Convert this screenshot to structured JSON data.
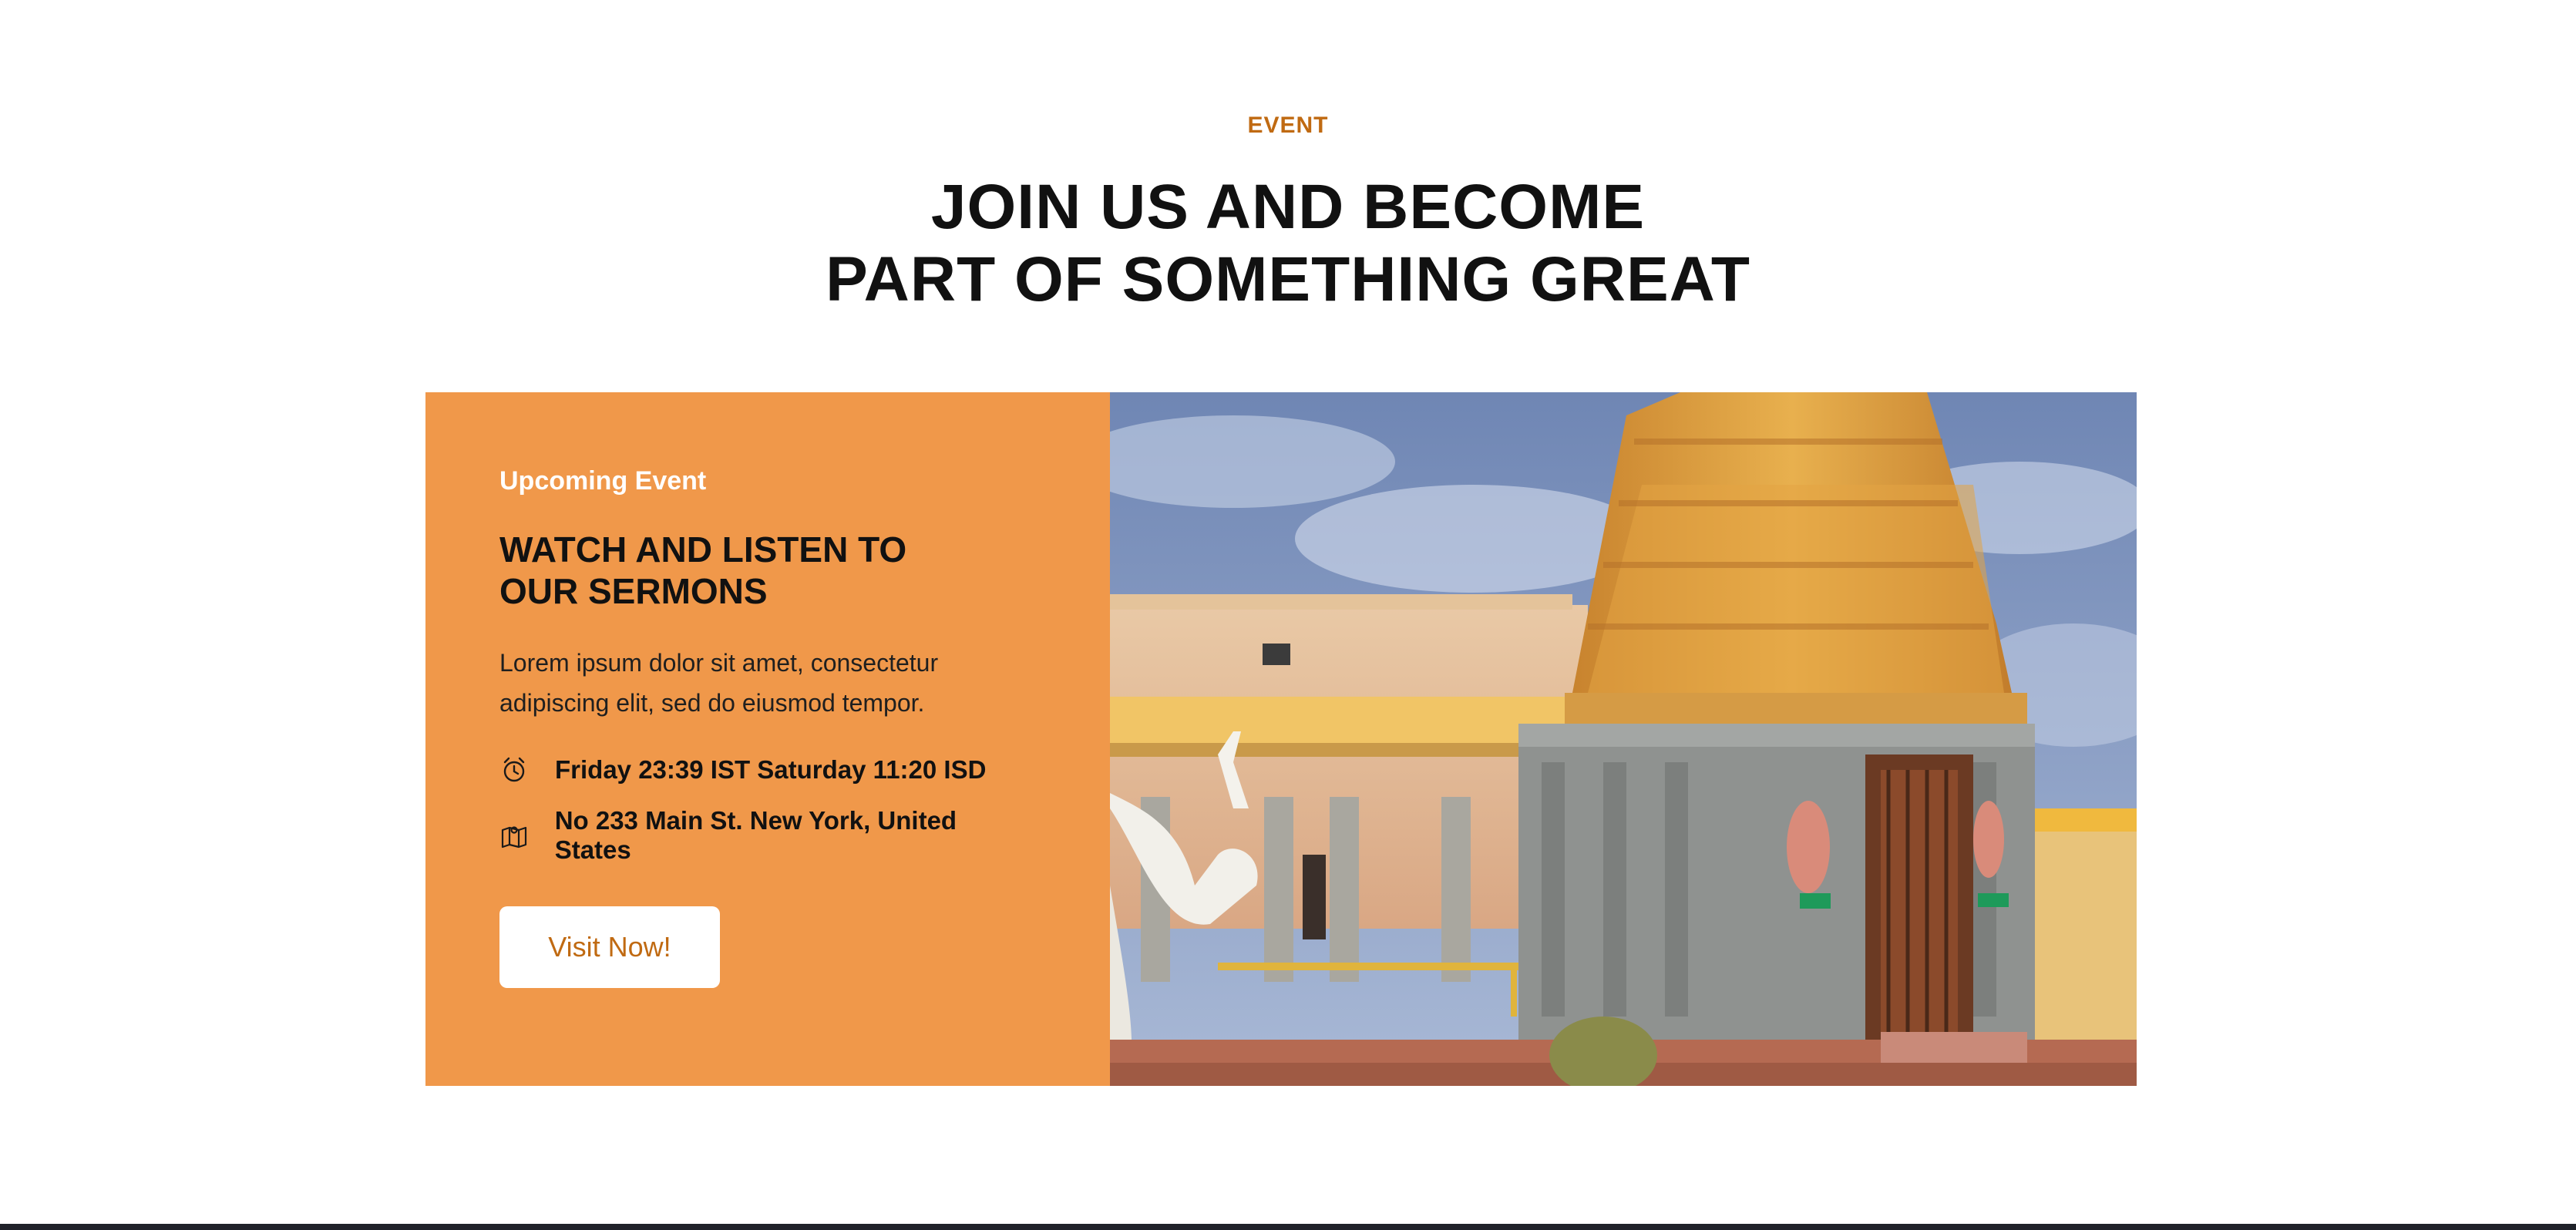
{
  "section": {
    "eyebrow": "EVENT",
    "heading_line_1": "JOIN US AND BECOME",
    "heading_line_2": "PART OF SOMETHING GREAT"
  },
  "event": {
    "label": "Upcoming Event",
    "title": "WATCH AND LISTEN TO OUR SERMONS",
    "description": "Lorem ipsum dolor sit amet, consectetur adipiscing elit, sed do eiusmod tempor.",
    "time": "Friday 23:39 IST Saturday 11:20 ISD",
    "location": "No 233 Main St. New York, United States",
    "button_label": "Visit Now!",
    "icons": {
      "time": "alarm-clock-icon",
      "location": "map-icon"
    }
  },
  "colors": {
    "accent": "#c06a12",
    "card_background": "#f0984a",
    "heading": "#111111",
    "footer": "#20222a"
  }
}
